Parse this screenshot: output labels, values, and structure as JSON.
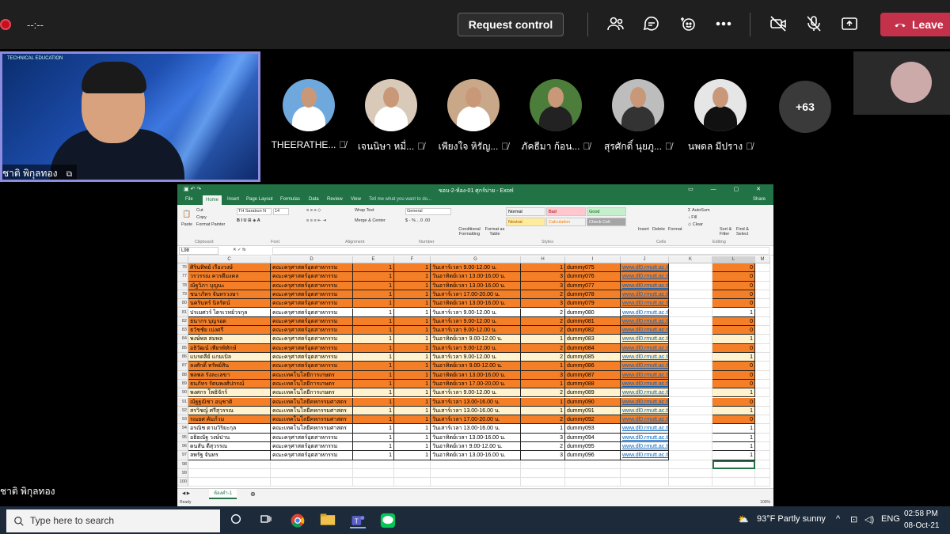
{
  "meeting": {
    "timer": "--:--",
    "request_control": "Request control",
    "leave": "Leave",
    "speaker_name": "ชาติ พิกุลทอง",
    "speaker_org": "TECHNICAL EDUCATION",
    "bottom_name": "ชาติ พิกุลทอง",
    "more_count": "+63",
    "participants": [
      {
        "name": "THEERATHE..."
      },
      {
        "name": "เจนนิษา หมื่..."
      },
      {
        "name": "เพียงใจ หิรัญ..."
      },
      {
        "name": "ภัคธีมา ก้อน..."
      },
      {
        "name": "สุรศักดิ์ นุยภู..."
      },
      {
        "name": "นพดล มีปราง"
      }
    ]
  },
  "excel": {
    "title": "ขอบ-2-ห้อง-01 ศุกร์บ่าย - Excel",
    "tabs": [
      "File",
      "Home",
      "Insert",
      "Page Layout",
      "Formulas",
      "Data",
      "Review",
      "View",
      "Tell me what you want to do..."
    ],
    "share": "Share",
    "font_name": "TH Sarabun N",
    "font_size": "14",
    "number_format": "General",
    "wrap_text": "Wrap Text",
    "merge_center": "Merge & Center",
    "cut": "Cut",
    "copy": "Copy",
    "format_painter": "Format Painter",
    "paste": "Paste",
    "conditional_formatting": "Conditional Formatting",
    "format_as_table": "Format as Table",
    "styles": [
      {
        "label": "Normal",
        "bg": "#ffffff",
        "fg": "#000000"
      },
      {
        "label": "Bad",
        "bg": "#ffc7ce",
        "fg": "#9c0006"
      },
      {
        "label": "Good",
        "bg": "#c6efce",
        "fg": "#006100"
      },
      {
        "label": "Neutral",
        "bg": "#ffeb9c",
        "fg": "#9c5700"
      },
      {
        "label": "Calculation",
        "bg": "#f2f2f2",
        "fg": "#fa7d00"
      },
      {
        "label": "Check Cell",
        "bg": "#a5a5a5",
        "fg": "#ffffff"
      }
    ],
    "cells_group": [
      "Insert",
      "Delete",
      "Format"
    ],
    "autosum": "AutoSum",
    "fill": "Fill",
    "clear": "Clear",
    "sort_filter": "Sort & Filter",
    "find_select": "Find & Select",
    "groups": [
      "Clipboard",
      "Font",
      "Alignment",
      "Number",
      "Styles",
      "Cells",
      "Editing"
    ],
    "name_box": "L98",
    "columns": [
      "C",
      "D",
      "E",
      "F",
      "G",
      "H",
      "I",
      "J",
      "K",
      "L",
      "M"
    ],
    "rows": [
      {
        "n": "76",
        "c": "ศิรินทิพย์ เรืองวงษ์",
        "d": "คณะครุศาสตร์อุตสาหกรรม",
        "e": "1",
        "f": "1",
        "g": "วันเสาร์เวลา 9.00-12.00 น.",
        "h": "1",
        "i": "dummy075",
        "j": "www.dl0.rmutt.ac.th",
        "l": "0",
        "fill": "org"
      },
      {
        "n": "77",
        "c": "วรวรรณ ควรดีมงคล",
        "d": "คณะครุศาสตร์อุตสาหกรรม",
        "e": "1",
        "f": "1",
        "g": "วันอาทิตย์เวลา 13.00-16.00 น.",
        "h": "3",
        "i": "dummy076",
        "j": "www.dl0.rmutt.ac.th",
        "l": "0",
        "fill": "org"
      },
      {
        "n": "78",
        "c": "ณัฐวิภา บุญนะ",
        "d": "คณะครุศาสตร์อุตสาหกรรม",
        "e": "1",
        "f": "1",
        "g": "วันอาทิตย์เวลา 13.00-16.00 น.",
        "h": "3",
        "i": "dummy077",
        "j": "www.dl0.rmutt.ac.th",
        "l": "0",
        "fill": "org"
      },
      {
        "n": "79",
        "c": "ชนาภัทร จันทรวงษา",
        "d": "คณะครุศาสตร์อุตสาหกรรม",
        "e": "1",
        "f": "1",
        "g": "วันเสาร์เวลา 17.00-20.00 น.",
        "h": "2",
        "i": "dummy078",
        "j": "www.dl0.rmutt.ac.th",
        "l": "0",
        "fill": "org"
      },
      {
        "n": "80",
        "c": "นครินทร์ นิลรัตน์",
        "d": "คณะครุศาสตร์อุตสาหกรรม",
        "e": "1",
        "f": "1",
        "g": "วันอาทิตย์เวลา 13.00-16.00 น.",
        "h": "3",
        "i": "dummy079",
        "j": "www.dl0.rmutt.ac.th",
        "l": "0",
        "fill": "org"
      },
      {
        "n": "81",
        "c": "ปรเมศวร์ ไตรเวทย์วรกุล",
        "d": "คณะครุศาสตร์อุตสาหกรรม",
        "e": "1",
        "f": "1",
        "g": "วันเสาร์เวลา 9.00-12.00 น.",
        "h": "2",
        "i": "dummy080",
        "j": "www.dl0.rmutt.ac.th",
        "l": "1",
        "fill": "wh"
      },
      {
        "n": "82",
        "c": "ธนากร บุญรอด",
        "d": "คณะครุศาสตร์อุตสาหกรรม",
        "e": "1",
        "f": "1",
        "g": "วันเสาร์เวลา 9.00-12.00 น.",
        "h": "2",
        "i": "dummy081",
        "j": "www.dl0.rmutt.ac.th",
        "l": "0",
        "fill": "org"
      },
      {
        "n": "83",
        "c": "ธวัชชัย เปงศรี",
        "d": "คณะครุศาสตร์อุตสาหกรรม",
        "e": "1",
        "f": "1",
        "g": "วันเสาร์เวลา 9.00-12.00 น.",
        "h": "2",
        "i": "dummy082",
        "j": "www.dl0.rmutt.ac.th",
        "l": "0",
        "fill": "org"
      },
      {
        "n": "84",
        "c": "พงษ์พล สมพล",
        "d": "คณะครุศาสตร์อุตสาหกรรม",
        "e": "1",
        "f": "1",
        "g": "วันอาทิตย์เวลา 9.00-12.00 น.",
        "h": "1",
        "i": "dummy083",
        "j": "www.dl0.rmutt.ac.th",
        "l": "1",
        "fill": "lt"
      },
      {
        "n": "85",
        "c": "อธิวัฒน์ เพียรพิทักษ์",
        "d": "คณะครุศาสตร์อุตสาหกรรม",
        "e": "1",
        "f": "1",
        "g": "วันเสาร์เวลา 9.00-12.00 น.",
        "h": "2",
        "i": "dummy084",
        "j": "www.dl0.rmutt.ac.th",
        "l": "0",
        "fill": "org"
      },
      {
        "n": "86",
        "c": "แบรดลีย์ แกมเบิล",
        "d": "คณะครุศาสตร์อุตสาหกรรม",
        "e": "1",
        "f": "1",
        "g": "วันเสาร์เวลา 9.00-12.00 น.",
        "h": "2",
        "i": "dummy085",
        "j": "www.dl0.rmutt.ac.th",
        "l": "1",
        "fill": "lt"
      },
      {
        "n": "87",
        "c": "ลงศักดิ์ ทรัพย์สิน",
        "d": "คณะครุศาสตร์อุตสาหกรรม",
        "e": "1",
        "f": "1",
        "g": "วันอาทิตย์เวลา 9.00-12.00 น.",
        "h": "1",
        "i": "dummy086",
        "j": "www.dl0.rmutt.ac.th",
        "l": "0",
        "fill": "org"
      },
      {
        "n": "88",
        "c": "พลพล รังละเลขา",
        "d": "คณะเทคโนโลยีการเกษตร",
        "e": "1",
        "f": "1",
        "g": "วันอาทิตย์เวลา 13.00-16.00 น.",
        "h": "3",
        "i": "dummy087",
        "j": "www.dl0.rmutt.ac.th",
        "l": "0",
        "fill": "org"
      },
      {
        "n": "89",
        "c": "ธนภัทร รัตนพงศ์ปกรณ์",
        "d": "คณะเทคโนโลยีการเกษตร",
        "e": "1",
        "f": "1",
        "g": "วันอาทิตย์เวลา 17.00-20.00 น.",
        "h": "1",
        "i": "dummy088",
        "j": "www.dl0.rmutt.ac.th",
        "l": "0",
        "fill": "org"
      },
      {
        "n": "90",
        "c": "พงศกร โพธิจักร์",
        "d": "คณะเทคโนโลยีการเกษตร",
        "e": "1",
        "f": "1",
        "g": "วันเสาร์เวลา 9.00-12.00 น.",
        "h": "2",
        "i": "dummy089",
        "j": "www.dl0.rmutt.ac.th",
        "l": "1",
        "fill": "lt"
      },
      {
        "n": "91",
        "c": "ณัฐฐณิชา อนุชาติ",
        "d": "คณะเทคโนโลยีคหกรรมศาสตร",
        "e": "1",
        "f": "1",
        "g": "วันเสาร์เวลา 13.00-16.00 น.",
        "h": "1",
        "i": "dummy090",
        "j": "www.dl0.rmutt.ac.th",
        "l": "0",
        "fill": "org"
      },
      {
        "n": "92",
        "c": "สรวิชญ์ ศรีสุวรรณ",
        "d": "คณะเทคโนโลยีคหกรรมศาสตร",
        "e": "1",
        "f": "1",
        "g": "วันเสาร์เวลา 13.00-16.00 น.",
        "h": "1",
        "i": "dummy091",
        "j": "www.dl0.rmutt.ac.th",
        "l": "1",
        "fill": "lt"
      },
      {
        "n": "93",
        "c": "รณยศ คัมภ์วม",
        "d": "คณะเทคโนโลยีคหกรรมศาสตร",
        "e": "1",
        "f": "1",
        "g": "วันเสาร์เวลา 17.00-20.00 น.",
        "h": "2",
        "i": "dummy092",
        "j": "www.dl0.rmutt.ac.th",
        "l": "0",
        "fill": "org"
      },
      {
        "n": "94",
        "c": "อรณิช ตามวิริยะกุล",
        "d": "คณะเทคโนโลยีคหกรรมศาสตร",
        "e": "1",
        "f": "1",
        "g": "วันเสาร์เวลา 13.00-16.00 น.",
        "h": "1",
        "i": "dummy093",
        "j": "www.dl0.rmutt.ac.th",
        "l": "1",
        "fill": "wh"
      },
      {
        "n": "95",
        "c": "อธิธณัฐ วงษ์ปาน",
        "d": "คณะครุศาสตร์อุตสาหกรรม",
        "e": "1",
        "f": "1",
        "g": "วันอาทิตย์เวลา 13.00-16.00 น.",
        "h": "3",
        "i": "dummy094",
        "j": "www.dl0.rmutt.ac.th",
        "l": "1",
        "fill": "wh"
      },
      {
        "n": "96",
        "c": "ดนสัน ดีสุวรรณ",
        "d": "คณะครุศาสตร์อุตสาหกรรม",
        "e": "1",
        "f": "1",
        "g": "วันอาทิตย์เวลา 9.00-12.00 น.",
        "h": "2",
        "i": "dummy095",
        "j": "www.dl0.rmutt.ac.th",
        "l": "1",
        "fill": "wh"
      },
      {
        "n": "97",
        "c": "ลพรัฐ จันทร",
        "d": "คณะครุศาสตร์อุตสาหกรรม",
        "e": "1",
        "f": "1",
        "g": "วันอาทิตย์เวลา 13.00-16.00 น.",
        "h": "3",
        "i": "dummy096",
        "j": "www.dl0.rmutt.ac.th",
        "l": "1",
        "fill": "wh"
      }
    ],
    "empty_rows": [
      "98",
      "99",
      "100"
    ],
    "sheet_tab": "ห้องดำ-1",
    "status": "Ready",
    "zoom": "100%"
  },
  "taskbar": {
    "search_placeholder": "Type here to search",
    "weather": "93°F  Partly sunny",
    "lang": "ENG",
    "time": "02:58 PM",
    "date": "08-Oct-21"
  }
}
